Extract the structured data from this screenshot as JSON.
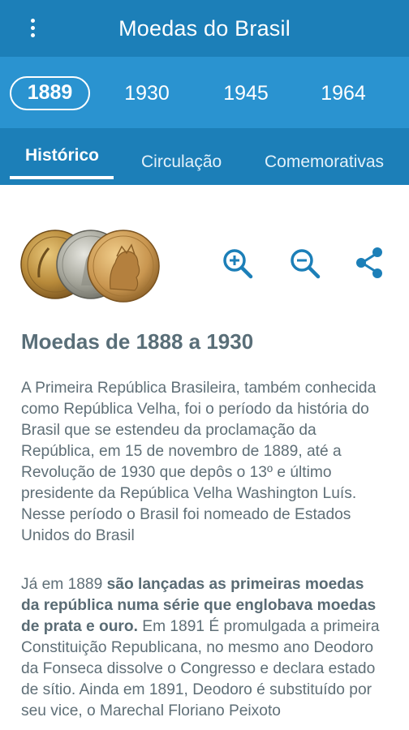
{
  "appbar": {
    "title": "Moedas do Brasil",
    "menu_icon": "more-vert-icon"
  },
  "years": [
    "1889",
    "1930",
    "1945",
    "1964"
  ],
  "selected_year": "1889",
  "tabs": [
    {
      "label": "Histórico",
      "active": true
    },
    {
      "label": "Circulação",
      "active": false
    },
    {
      "label": "Comemorativas",
      "active": false
    }
  ],
  "icons": {
    "zoom_in": "zoom-in-icon",
    "zoom_out": "zoom-out-icon",
    "share": "share-icon"
  },
  "colors": {
    "appbar": "#1c7fb8",
    "year_bar": "#2a93d0",
    "icon": "#1c7fb8",
    "text": "#5f6f77"
  },
  "article": {
    "title": "Moedas de 1888 a 1930",
    "p1": "A Primeira República Brasileira, também conhecida como República Velha, foi o período da história do Brasil que se estendeu da proclamação da República, em 15 de novembro de 1889, até a Revolução de 1930 que depôs o 13º e último presidente da República Velha Washington Luís. Nesse período o Brasil foi nomeado de Estados Unidos do Brasil",
    "p2_lead": "Já em 1889 ",
    "p2_bold": "são lançadas as primeiras moedas da república numa série que englobava moedas de prata e ouro.",
    "p2_rest": " Em 1891 É promulgada a primeira Constituição Republicana, no mesmo ano Deodoro da Fonseca dissolve o Congresso e declara estado de sítio. Ainda em 1891, Deodoro é substituído por seu vice, o Marechal Floriano Peixoto"
  }
}
